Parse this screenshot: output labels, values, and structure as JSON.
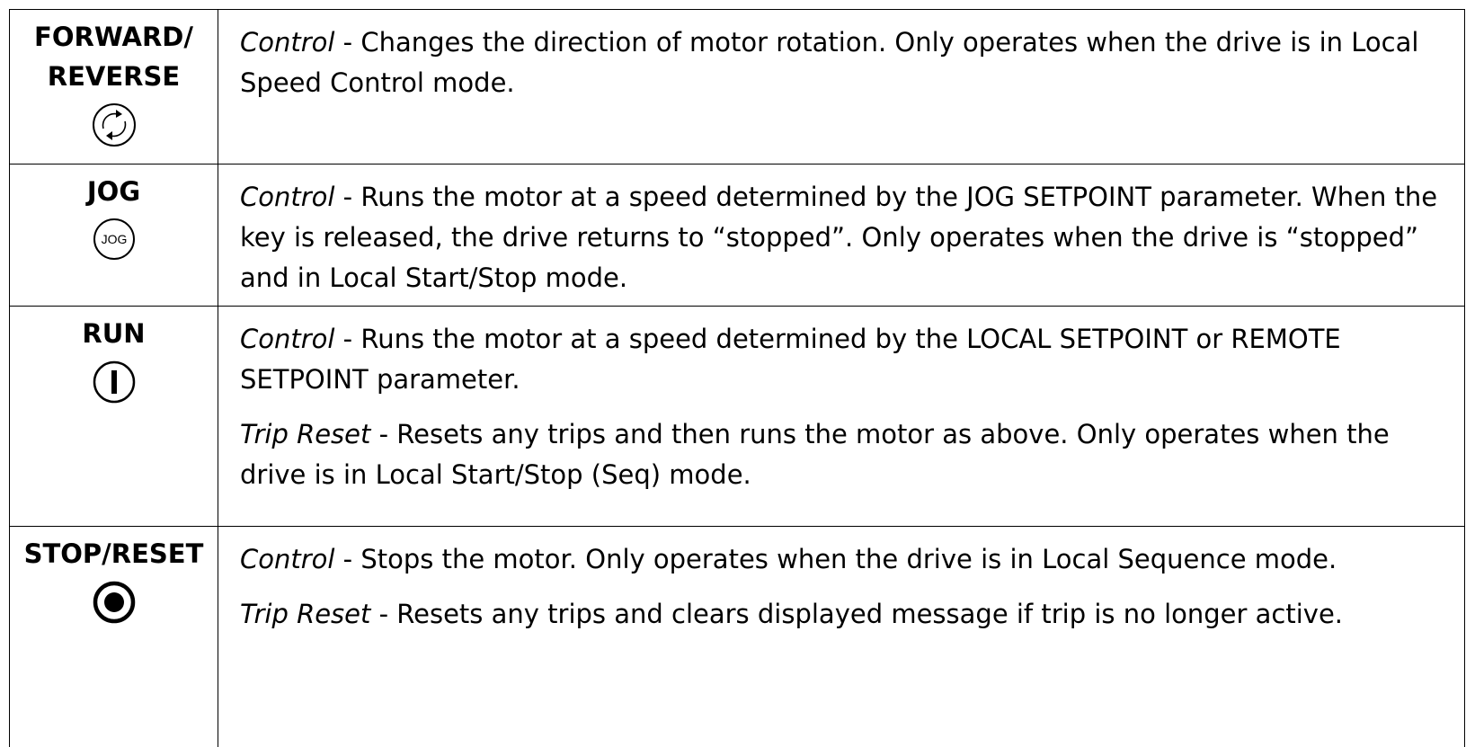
{
  "rows": [
    {
      "key": "FORWARD/\nREVERSE",
      "key_line1": "FORWARD/",
      "key_line2": "REVERSE",
      "icon": "forward-reverse-icon",
      "paragraphs": [
        {
          "term": "Control",
          "text": " - Changes the direction of motor rotation. Only operates when the drive is in Local Speed Control mode."
        }
      ]
    },
    {
      "key_line1": "JOG",
      "icon": "jog-icon",
      "icon_label": "JOG",
      "paragraphs": [
        {
          "term": "Control",
          "text": " - Runs the motor at a speed determined by the JOG SETPOINT parameter. When the key is released, the drive returns to “stopped”. Only operates when the drive is “stopped” and in Local Start/Stop mode."
        }
      ]
    },
    {
      "key_line1": "RUN",
      "icon": "run-icon",
      "paragraphs": [
        {
          "term": "Control",
          "text": " - Runs the motor at a speed determined by the LOCAL SETPOINT or REMOTE SETPOINT parameter."
        },
        {
          "term": "Trip Reset",
          "text": " - Resets any trips and then runs the motor as above. Only operates when the drive is in Local Start/Stop (Seq) mode."
        }
      ]
    },
    {
      "key_line1": "STOP/RESET",
      "icon": "stop-reset-icon",
      "paragraphs": [
        {
          "term": "Control",
          "text": " - Stops the motor. Only operates when the drive is in Local Sequence mode."
        },
        {
          "term": "Trip Reset",
          "text": " - Resets any trips and clears displayed message if trip is no longer active."
        }
      ]
    }
  ]
}
